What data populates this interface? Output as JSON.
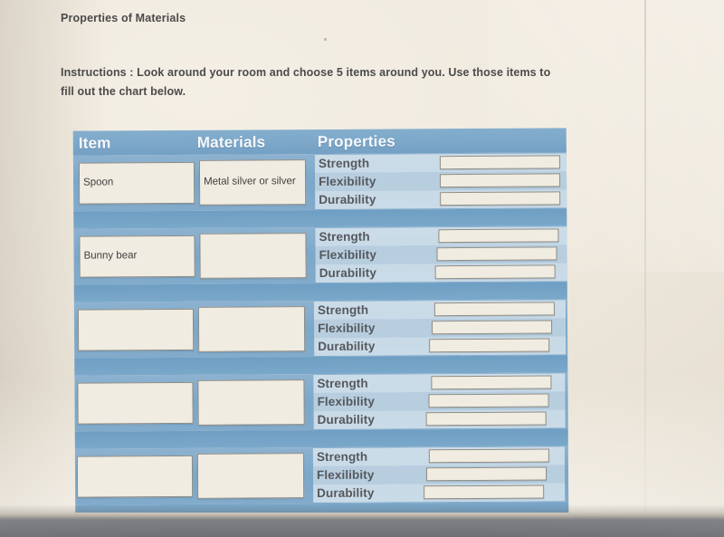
{
  "document": {
    "title": "Properties of Materials",
    "instructions": "Instructions : Look around your room and choose 5 items around you. Use those items to fill out the chart below."
  },
  "table": {
    "headers": {
      "item": "Item",
      "materials": "Materials",
      "properties": "Properties"
    },
    "rows": [
      {
        "item": "Spoon",
        "materials": "Metal silver or silver",
        "properties": [
          {
            "label": "Strength",
            "value": ""
          },
          {
            "label": "Flexibility",
            "value": ""
          },
          {
            "label": "Durability",
            "value": ""
          }
        ]
      },
      {
        "item": "Bunny bear",
        "materials": "",
        "properties": [
          {
            "label": "Strength",
            "value": ""
          },
          {
            "label": "Flexibility",
            "value": ""
          },
          {
            "label": "Durability",
            "value": ""
          }
        ]
      },
      {
        "item": "",
        "materials": "",
        "properties": [
          {
            "label": "Strength",
            "value": ""
          },
          {
            "label": "Flexibility",
            "value": ""
          },
          {
            "label": "Durability",
            "value": ""
          }
        ]
      },
      {
        "item": "",
        "materials": "",
        "properties": [
          {
            "label": "Strength",
            "value": ""
          },
          {
            "label": "Flexibility",
            "value": ""
          },
          {
            "label": "Durability",
            "value": ""
          }
        ]
      },
      {
        "item": "",
        "materials": "",
        "properties": [
          {
            "label": "Strength",
            "value": ""
          },
          {
            "label": "Flexilibity",
            "value": ""
          },
          {
            "label": "Durability",
            "value": ""
          }
        ]
      }
    ]
  },
  "colors": {
    "table_blue": "#7aa6c8",
    "header_blue": "#7ca7c9",
    "box_fill": "#f1ece1",
    "paper": "#efe9de",
    "text": "#4a4a4a",
    "prop_label_text": "#55585c"
  }
}
